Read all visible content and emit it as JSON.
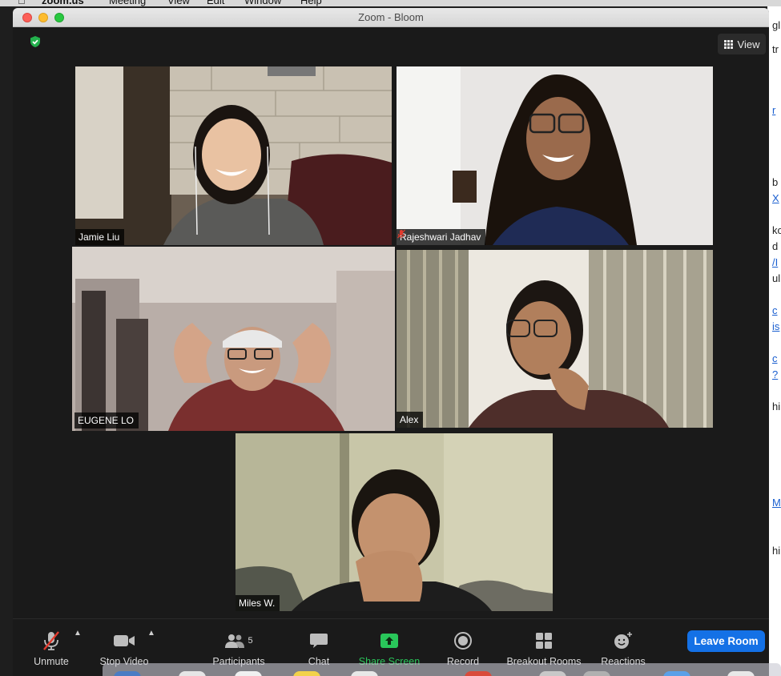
{
  "menubar": {
    "items": [
      "zoom.us",
      "Meeting",
      "View",
      "Edit",
      "Window",
      "Help"
    ]
  },
  "window": {
    "title": "Zoom - Bloom"
  },
  "top": {
    "view_label": "View",
    "shield_icon": "shield-check-icon"
  },
  "participants_tiles": [
    {
      "name": "Jamie Liu",
      "muted": false,
      "active_speaker": false
    },
    {
      "name": "Rajeshwari Jadhav",
      "muted": true,
      "active_speaker": false
    },
    {
      "name": "EUGENE LO",
      "muted": false,
      "active_speaker": true
    },
    {
      "name": "Alex",
      "muted": false,
      "active_speaker": false
    },
    {
      "name": "Miles W.",
      "muted": false,
      "active_speaker": false
    }
  ],
  "toolbar": {
    "unmute": "Unmute",
    "stop_video": "Stop Video",
    "participants": "Participants",
    "participants_count": "5",
    "chat": "Chat",
    "share_screen": "Share Screen",
    "record": "Record",
    "breakout_rooms": "Breakout Rooms",
    "reactions": "Reactions",
    "leave": "Leave Room"
  },
  "colors": {
    "active_speaker_border": "#d8e682",
    "share_green": "#29c65a",
    "leave_blue": "#1471e6",
    "mute_red": "#e23b2e"
  },
  "background_page_fragments": [
    "gl",
    "tr",
    "r",
    "b",
    "X",
    "ko",
    "d",
    "/I",
    "ul",
    "c",
    "is",
    "c",
    "?",
    "hi",
    "M",
    "hi"
  ]
}
